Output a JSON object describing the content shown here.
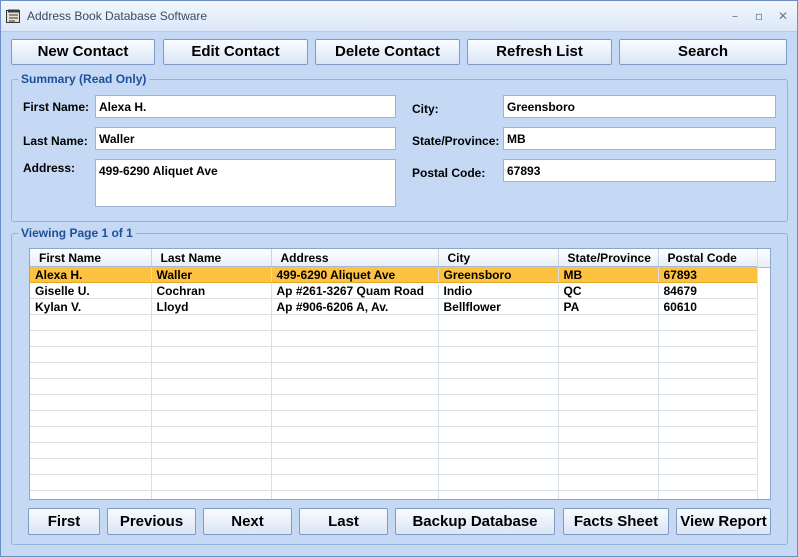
{
  "window": {
    "title": "Address Book Database Software"
  },
  "toolbar": {
    "new_contact": "New Contact",
    "edit_contact": "Edit Contact",
    "delete_contact": "Delete Contact",
    "refresh_list": "Refresh List",
    "search": "Search"
  },
  "summary": {
    "legend": "Summary (Read Only)",
    "first_name_label": "First Name:",
    "first_name": "Alexa H.",
    "last_name_label": "Last Name:",
    "last_name": "Waller",
    "address_label": "Address:",
    "address": "499-6290 Aliquet Ave",
    "city_label": "City:",
    "city": "Greensboro",
    "state_label": "State/Province:",
    "state": "MB",
    "postal_label": "Postal Code:",
    "postal": "67893"
  },
  "viewing": {
    "legend": "Viewing Page 1 of 1",
    "columns": [
      "First Name",
      "Last Name",
      "Address",
      "City",
      "State/Province",
      "Postal Code"
    ],
    "rows": [
      [
        "Alexa H.",
        "Waller",
        "499-6290 Aliquet Ave",
        "Greensboro",
        "MB",
        "67893"
      ],
      [
        "Giselle U.",
        "Cochran",
        "Ap #261-3267 Quam Road",
        "Indio",
        "QC",
        "84679"
      ],
      [
        "Kylan V.",
        "Lloyd",
        "Ap #906-6206 A, Av.",
        "Bellflower",
        "PA",
        "60610"
      ]
    ]
  },
  "nav": {
    "first": "First",
    "previous": "Previous",
    "next": "Next",
    "last": "Last",
    "backup": "Backup Database",
    "facts": "Facts Sheet",
    "report": "View Report"
  },
  "colors": {
    "selected_row": "#fdc23f",
    "background": "#c5d9f5",
    "legend": "#1f4f97"
  }
}
